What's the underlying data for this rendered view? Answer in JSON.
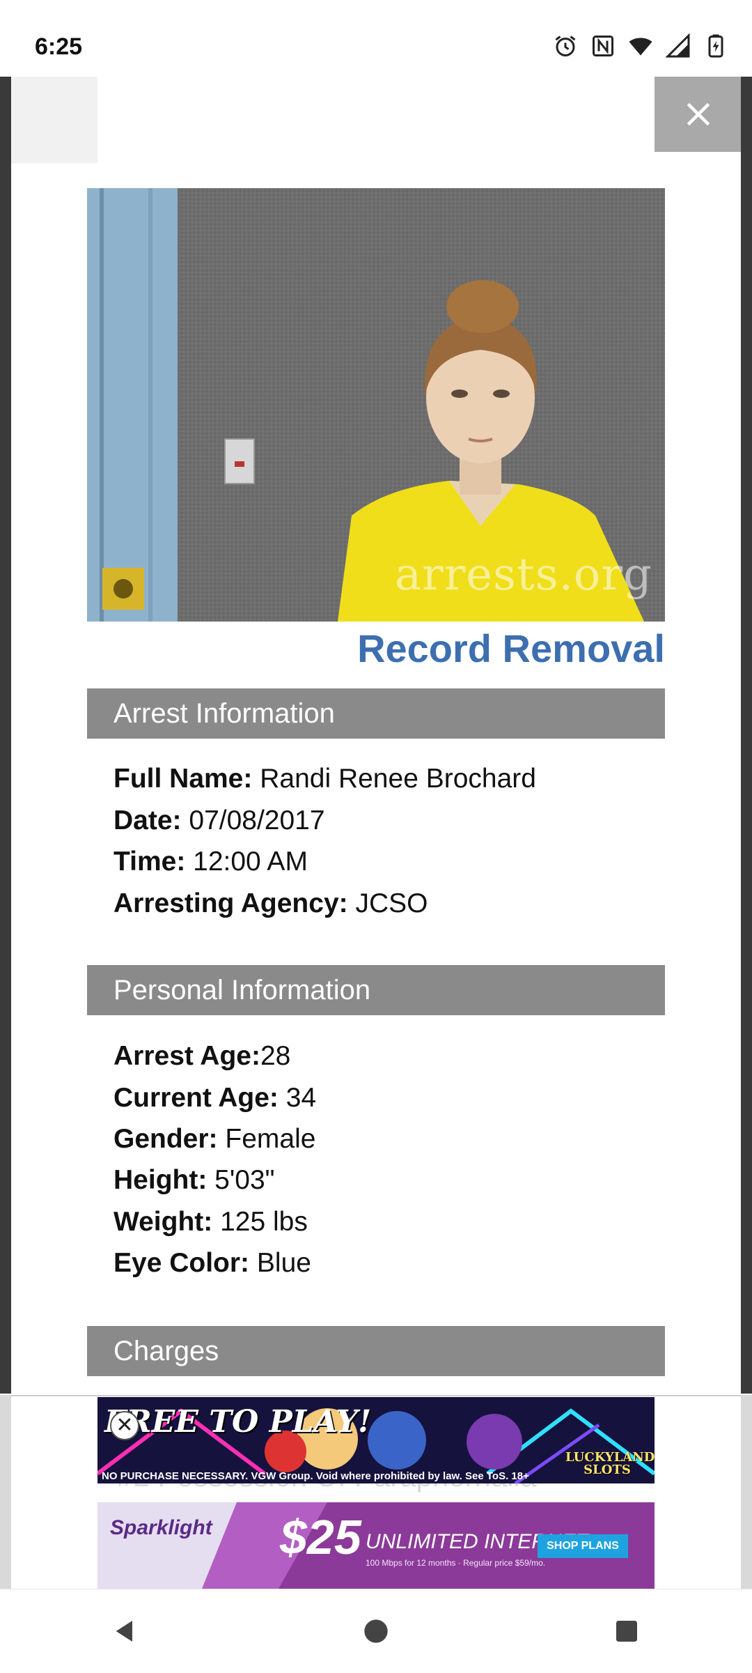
{
  "status_bar": {
    "time": "6:25",
    "icons": [
      "alarm-icon",
      "nfc-icon",
      "wifi-icon",
      "cell-signal-icon",
      "battery-charging-icon"
    ]
  },
  "overlay": {
    "close_icon": "close-icon"
  },
  "photo": {
    "watermark": "arrests.org"
  },
  "record_removal_label": "Record Removal",
  "arrest_information": {
    "heading": "Arrest Information",
    "full_name_label": "Full Name:",
    "full_name": "Randi Renee Brochard",
    "date_label": "Date:",
    "date": "07/08/2017",
    "time_label": "Time:",
    "time": "12:00 AM",
    "agency_label": "Arresting Agency:",
    "agency": "JCSO"
  },
  "personal_information": {
    "heading": "Personal Information",
    "arrest_age_label": "Arrest Age:",
    "arrest_age": "28",
    "current_age_label": "Current Age:",
    "current_age": "34",
    "gender_label": "Gender:",
    "gender": "Female",
    "height_label": "Height:",
    "height": "5'03\"",
    "weight_label": "Weight:",
    "weight": "125 lbs",
    "eye_color_label": "Eye Color:",
    "eye_color": "Blue"
  },
  "charges": {
    "heading": "Charges",
    "partial_charge": "#2 Possession Of Paraphernalia"
  },
  "ads": {
    "ad1": {
      "headline": "FREE TO PLAY!",
      "fine_print": "NO PURCHASE NECESSARY. VGW Group. Void where prohibited by law. See ToS. 18+",
      "brand": "LUCKYLAND SLOTS",
      "close_glyph": "✕"
    },
    "ad2": {
      "brand": "Sparklight",
      "price": "$25",
      "offer": "UNLIMITED INTERNET",
      "sub": "100 Mbps for 12 months · Regular price $59/mo.",
      "cta": "SHOP PLANS"
    }
  },
  "nav_bar": {
    "icons": [
      "back-icon",
      "home-icon",
      "recents-icon"
    ]
  },
  "colors": {
    "accent_link": "#3d6fb0",
    "section_bar": "#8a8a8a",
    "ad2_purple": "#8c3a9a"
  }
}
